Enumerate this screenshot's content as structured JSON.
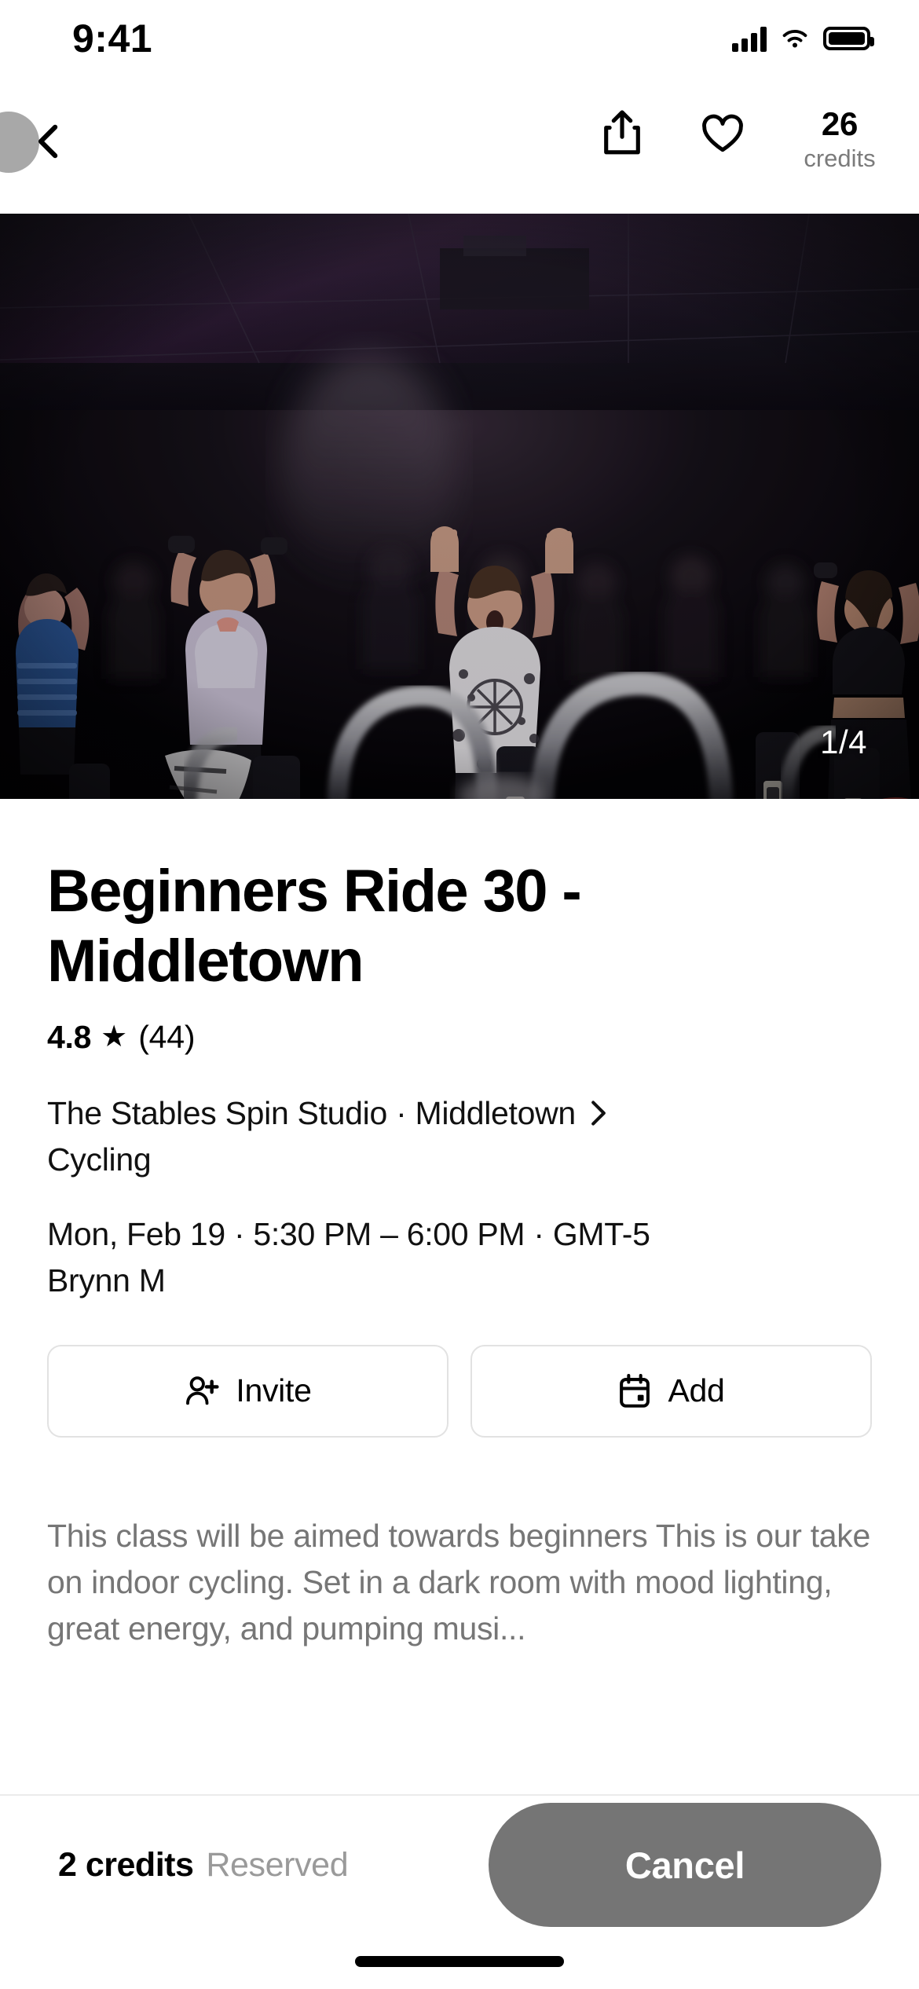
{
  "status_bar": {
    "time": "9:41",
    "icons": [
      "cellular-signal-icon",
      "wifi-icon",
      "battery-icon"
    ]
  },
  "nav_bar": {
    "back_icon": "chevron-left-icon",
    "share_icon": "share-icon",
    "favorite_icon": "heart-outline-icon",
    "credits_value": "26",
    "credits_label": "credits"
  },
  "hero": {
    "counter": "1/4",
    "alt": "dark indoor cycling studio with riders raising arms on spin bikes"
  },
  "class": {
    "title": "Beginners Ride 30 - Middletown",
    "rating_value": "4.8",
    "rating_star": "★",
    "rating_count": "(44)",
    "studio": "The Stables Spin Studio · Middletown",
    "studio_chevron": "chevron-right-icon",
    "category": "Cycling",
    "schedule": "Mon, Feb 19 · 5:30 PM – 6:00 PM · GMT-5",
    "instructor": "Brynn M",
    "description": "This class will be aimed towards beginners This is our take on indoor cycling. Set in a dark room with mood lighting, great energy, and pumping musi..."
  },
  "actions": {
    "invite_label": "Invite",
    "invite_icon": "person-add-icon",
    "add_label": "Add",
    "add_icon": "calendar-icon"
  },
  "booking_bar": {
    "price": "2 credits",
    "status": "Reserved",
    "cta_label": "Cancel"
  },
  "colors": {
    "background": "#ffffff",
    "text_primary": "#000000",
    "text_muted": "#767676",
    "border": "#e2e2e2",
    "cancel_button": "#757575",
    "back_circle": "#a8a8a8"
  }
}
